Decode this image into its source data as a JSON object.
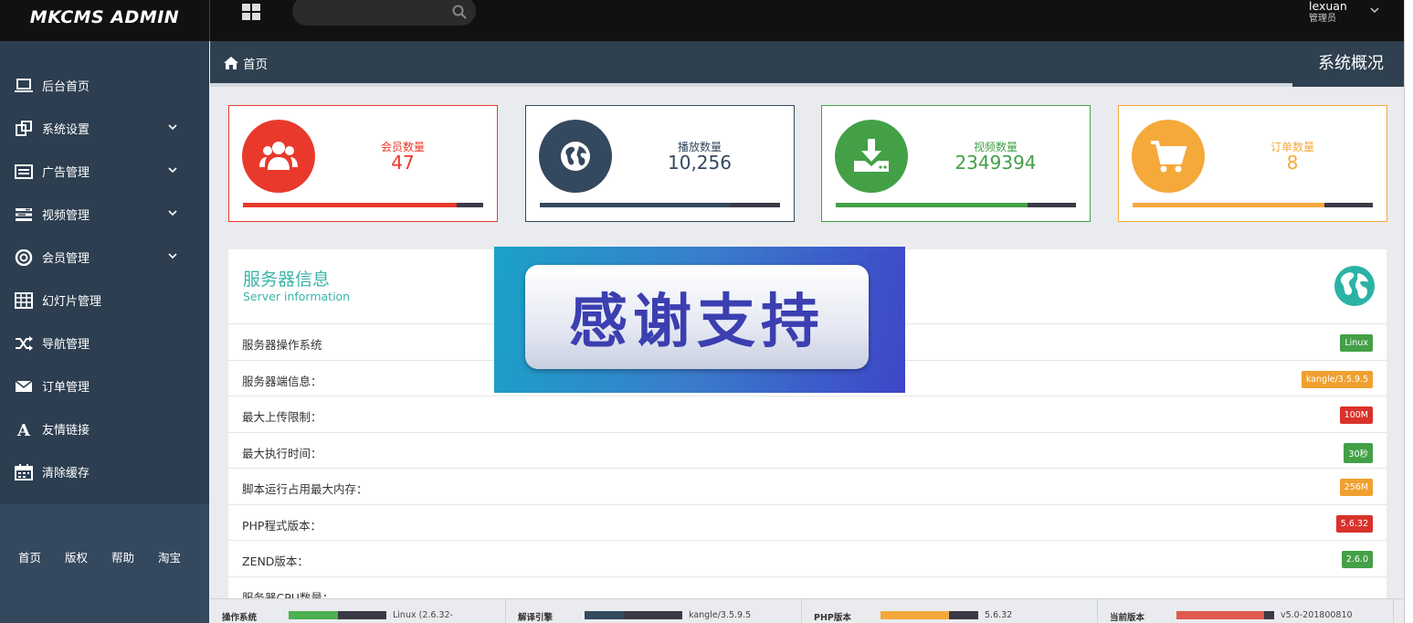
{
  "app": {
    "logo": "MKCMS ADMIN"
  },
  "topbar": {
    "search_placeholder": "",
    "user_name": "lexuan",
    "user_role": "管理员"
  },
  "sidebar": {
    "items": [
      {
        "label": "后台首页",
        "icon": "laptop-icon",
        "has_submenu": false
      },
      {
        "label": "系统设置",
        "icon": "settings-icon",
        "has_submenu": true
      },
      {
        "label": "广告管理",
        "icon": "list-icon",
        "has_submenu": true
      },
      {
        "label": "视频管理",
        "icon": "tasks-icon",
        "has_submenu": true
      },
      {
        "label": "会员管理",
        "icon": "lifebuoy-icon",
        "has_submenu": true
      },
      {
        "label": "幻灯片管理",
        "icon": "table-icon",
        "has_submenu": false
      },
      {
        "label": "导航管理",
        "icon": "random-icon",
        "has_submenu": false
      },
      {
        "label": "订单管理",
        "icon": "envelope-icon",
        "has_submenu": false
      },
      {
        "label": "友情链接",
        "icon": "font-icon",
        "has_submenu": false
      },
      {
        "label": "清除缓存",
        "icon": "calendar-icon",
        "has_submenu": false
      }
    ],
    "footer_links": [
      "首页",
      "版权",
      "帮助",
      "淘宝"
    ]
  },
  "breadcrumb": {
    "home": "首页",
    "page_title": "系统概况"
  },
  "stats": [
    {
      "label": "会员数量",
      "value": "47",
      "color": "#e8392c",
      "bar_fill": 0.89,
      "icon": "users-icon"
    },
    {
      "label": "播放数量",
      "value": "10,256",
      "color": "#34495e",
      "bar_fill": 0.79,
      "icon": "globe-icon"
    },
    {
      "label": "视频数量",
      "value": "2349394",
      "color": "#43a047",
      "bar_fill": 0.8,
      "icon": "download-icon"
    },
    {
      "label": "订单数量",
      "value": "8",
      "color": "#f5a93b",
      "bar_fill": 0.8,
      "icon": "cart-icon"
    }
  ],
  "server": {
    "title": "服务器信息",
    "subtitle": "Server information",
    "rows": [
      {
        "label": "服务器操作系统",
        "value": "Linux",
        "color": "#43a047"
      },
      {
        "label": "服务器端信息：",
        "value": "kangle/3.5.9.5",
        "color": "#f0a030"
      },
      {
        "label": "最大上传限制：",
        "value": "100M",
        "color": "#d9322a"
      },
      {
        "label": "最大执行时间：",
        "value": "30秒",
        "color": "#43a047"
      },
      {
        "label": "脚本运行占用最大内存：",
        "value": "256M",
        "color": "#f0a030"
      },
      {
        "label": "PHP程式版本：",
        "value": "5.6.32",
        "color": "#d9322a"
      },
      {
        "label": "ZEND版本：",
        "value": "2.6.0",
        "color": "#43a047"
      },
      {
        "label": "服务器CPU数量：",
        "value": "",
        "color": "#43a047"
      }
    ]
  },
  "overlay": {
    "text": "感谢支持"
  },
  "statusbar": [
    {
      "label": "操作系统",
      "value": "Linux (2.6.32-",
      "color": "#4caf50",
      "fill": 0.5
    },
    {
      "label": "解译引擎",
      "value": "kangle/3.5.9.5",
      "color": "#34495e",
      "fill": 0.4
    },
    {
      "label": "PHP版本",
      "value": "5.6.32",
      "color": "#f5a93b",
      "fill": 0.7
    },
    {
      "label": "当前版本",
      "value": "v5.0-201800810",
      "color": "#e05a50",
      "fill": 0.9
    }
  ]
}
